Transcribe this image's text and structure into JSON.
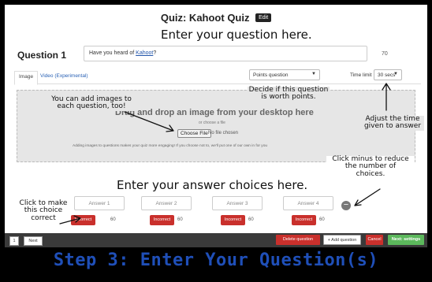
{
  "quiz": {
    "title": "Quiz: Kahoot Quiz",
    "edit_label": "Edit"
  },
  "annotations": {
    "enter_question": "Enter your question here.",
    "add_images": "You can add images to\neach question, too!",
    "points": "Decide if this question\nis worth points.",
    "adjust_time": "Adjust the time\ngiven to answer",
    "enter_answers": "Enter your answer choices here.",
    "reduce_choices": "Click minus to reduce\nthe number of\nchoices.",
    "make_correct": "Click to make\nthis choice\ncorrect"
  },
  "question": {
    "label": "Question 1",
    "text_before_link": "Have you heard of ",
    "text_link": "Kahoot",
    "text_after_link": "?",
    "char_count": "70"
  },
  "tabs": [
    {
      "label": "Image"
    },
    {
      "label": "Video (Experimental)"
    }
  ],
  "points_select": {
    "value": "Points question"
  },
  "time_limit": {
    "label": "Time limit",
    "value": "30 secs"
  },
  "dropzone": {
    "main_text": "Drag and drop an image from your desktop here",
    "or_text": "or choose a file",
    "choose_button": "Choose File",
    "no_file": "No file chosen",
    "hint": "Adding images to questions makes your quiz more engaging! If you choose not to, we'll put one of our own in for you"
  },
  "answers": [
    {
      "placeholder": "Answer 1",
      "status": "Incorrect",
      "points": "60"
    },
    {
      "placeholder": "Answer 2",
      "status": "Incorrect",
      "points": "60"
    },
    {
      "placeholder": "Answer 3",
      "status": "Incorrect",
      "points": "60"
    },
    {
      "placeholder": "Answer 4",
      "status": "Incorrect",
      "points": "60"
    }
  ],
  "minus_symbol": "−",
  "footer": {
    "page": "1",
    "next": "Next",
    "delete": "Delete question",
    "add": "+ Add question",
    "cancel": "Cancel",
    "next_settings": "Next: settings"
  },
  "caption": "Step 3: Enter Your Question(s)",
  "colors": {
    "incorrect_red": "#c9302c",
    "next_green": "#5cb85c",
    "caption_blue": "#1f4fb8",
    "link_blue": "#2a62b5"
  }
}
